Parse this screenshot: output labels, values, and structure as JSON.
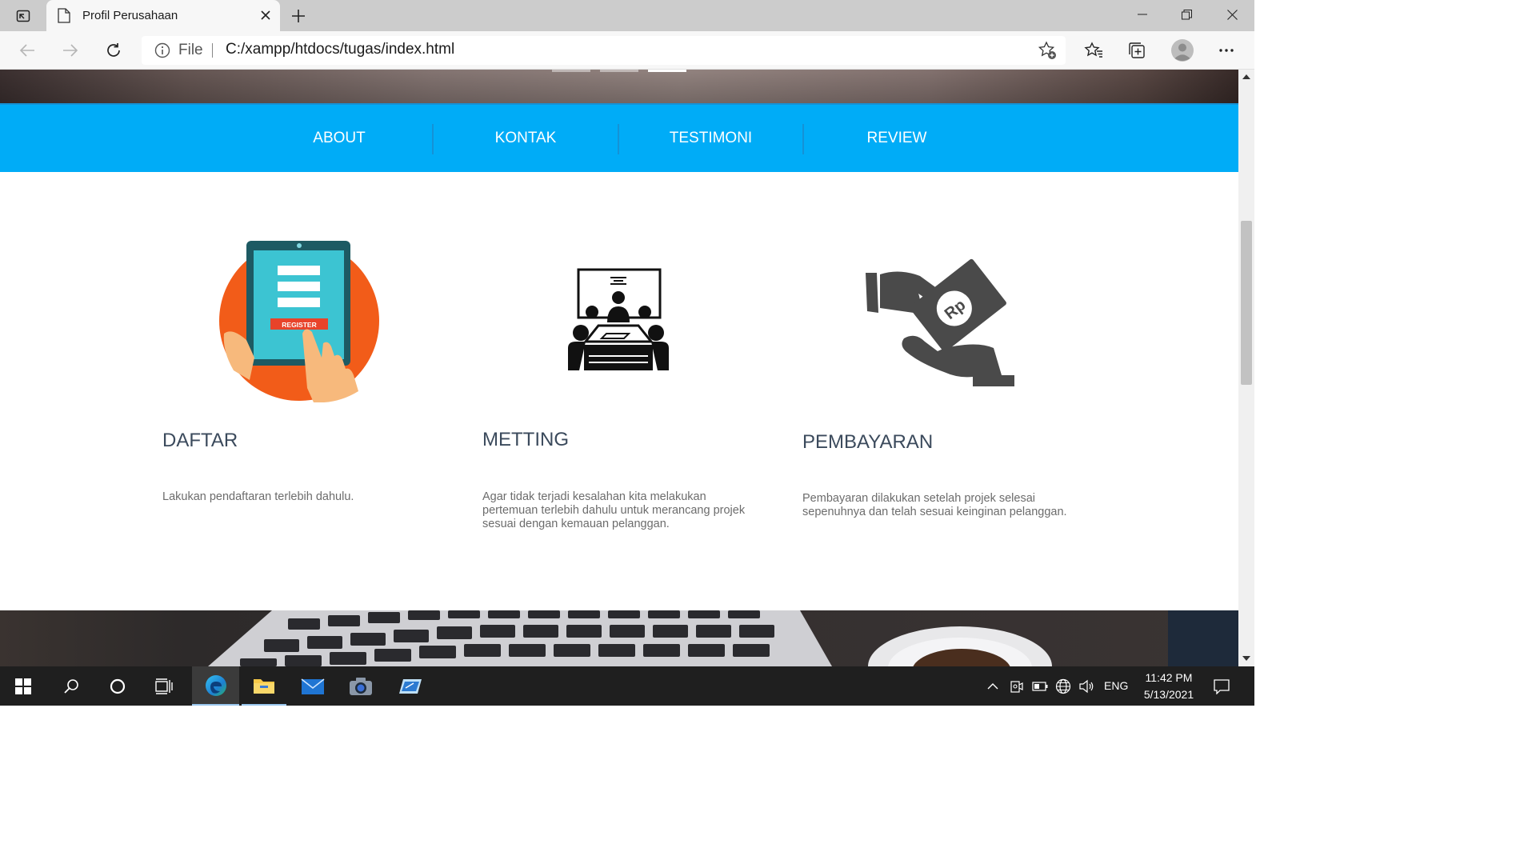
{
  "browser": {
    "tab_title": "Profil Perusahaan",
    "address_scheme_label": "File",
    "url": "C:/xampp/htdocs/tugas/index.html"
  },
  "nav": {
    "items": [
      {
        "label": "ABOUT"
      },
      {
        "label": "KONTAK"
      },
      {
        "label": "TESTIMONI"
      },
      {
        "label": "REVIEW"
      }
    ]
  },
  "features": [
    {
      "title": "DAFTAR",
      "desc_lines": [
        "Lakukan pendaftaran terlebih dahulu."
      ],
      "image_text": "REGISTER"
    },
    {
      "title": "METTING",
      "desc_lines": [
        "Agar tidak terjadi kesalahan kita melakukan",
        "pertemuan terlebih dahulu untuk merancang projek",
        "sesuai dengan kemauan pelanggan."
      ]
    },
    {
      "title": "PEMBAYARAN",
      "desc_lines": [
        "Pembayaran dilakukan setelah projek selesai",
        "sepenuhnya dan telah sesuai keinginan pelanggan."
      ],
      "image_text": "Rp"
    }
  ],
  "taskbar": {
    "lang": "ENG",
    "time": "11:42 PM",
    "date": "5/13/2021"
  },
  "colors": {
    "nav_bg": "#00acf7",
    "title_color": "#3b4a5c",
    "desc_color": "#6c6c6c"
  }
}
